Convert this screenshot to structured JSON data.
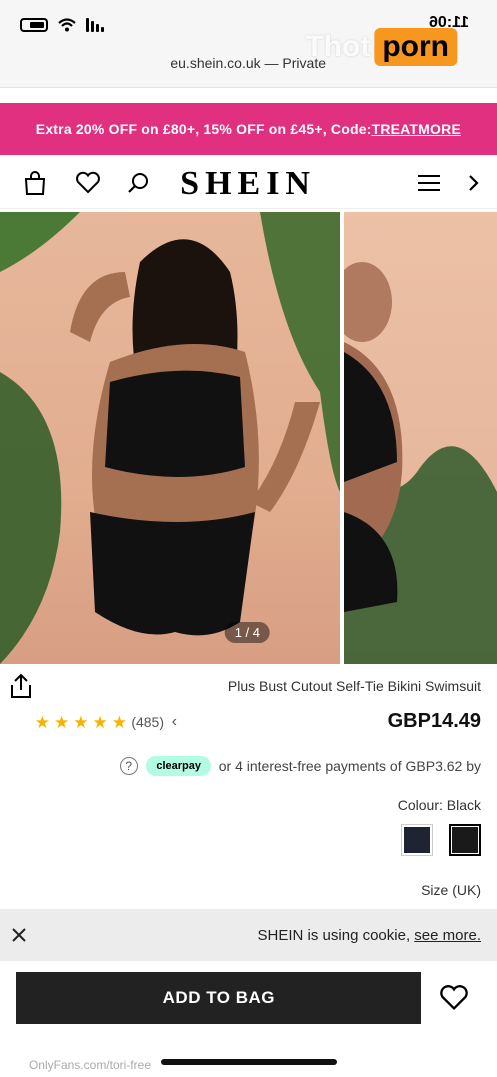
{
  "status_bar": {
    "time": "11:06"
  },
  "browser": {
    "url": "eu.shein.co.uk — Private"
  },
  "promo": {
    "text": "Extra 20% OFF on £80+, 15% OFF on £45+, Code:",
    "code": "TREATMORE"
  },
  "header": {
    "brand": "SHEIN"
  },
  "gallery": {
    "counter": "1 / 4"
  },
  "product": {
    "name": "Plus Bust Cutout Self-Tie Bikini Swimsuit",
    "price": "GBP14.49",
    "rating_stars": 4.5,
    "review_count": "(485)",
    "installment_text": "or 4 interest-free payments of GBP3.62 by",
    "clearpay_label": "clearpay",
    "colour_label": "Colour: Black",
    "size_label": "Size (UK)",
    "swatches": [
      {
        "name": "Black",
        "color": "#1a1a1a"
      },
      {
        "name": "Navy",
        "color": "#1f2433"
      }
    ]
  },
  "cookie": {
    "text": "SHEIN is using cookie,",
    "link": "see more."
  },
  "actions": {
    "add_to_bag": "ADD TO BAG"
  },
  "watermarks": {
    "top_left": "Thot",
    "top_right": "porn",
    "bottom": "OnlyFans.com/tori-free"
  }
}
